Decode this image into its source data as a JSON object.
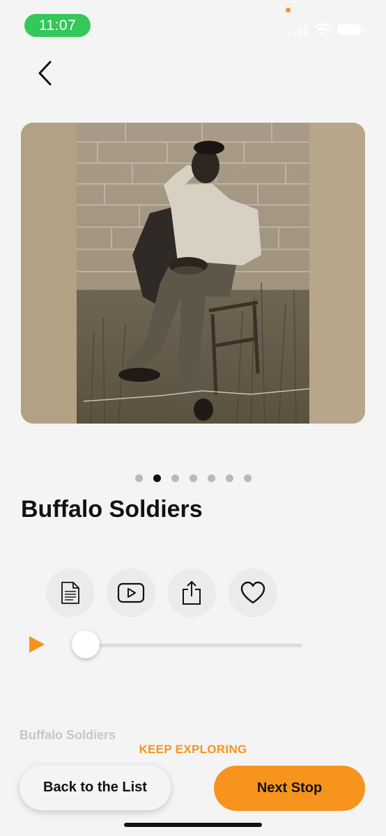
{
  "status_bar": {
    "time": "11:07"
  },
  "hero": {
    "description": "Sepia photograph of a uniformed soldier seated on a chair in front of a stone wall"
  },
  "carousel": {
    "count": 7,
    "active_index": 1
  },
  "title": "Buffalo Soldiers",
  "actions": [
    {
      "name": "transcript",
      "icon": "document-icon"
    },
    {
      "name": "video",
      "icon": "play-video-icon"
    },
    {
      "name": "share",
      "icon": "share-icon"
    },
    {
      "name": "favorite",
      "icon": "heart-icon"
    }
  ],
  "audio": {
    "progress": 0.0,
    "play_icon": "play-icon"
  },
  "faded_caption": "Buffalo Soldiers",
  "keep_exploring": "KEEP EXPLORING",
  "buttons": {
    "back_to_list": "Back to the List",
    "next_stop": "Next Stop"
  },
  "colors": {
    "accent": "#f7941d",
    "time_pill": "#34c759",
    "background": "#f4f4f4"
  }
}
